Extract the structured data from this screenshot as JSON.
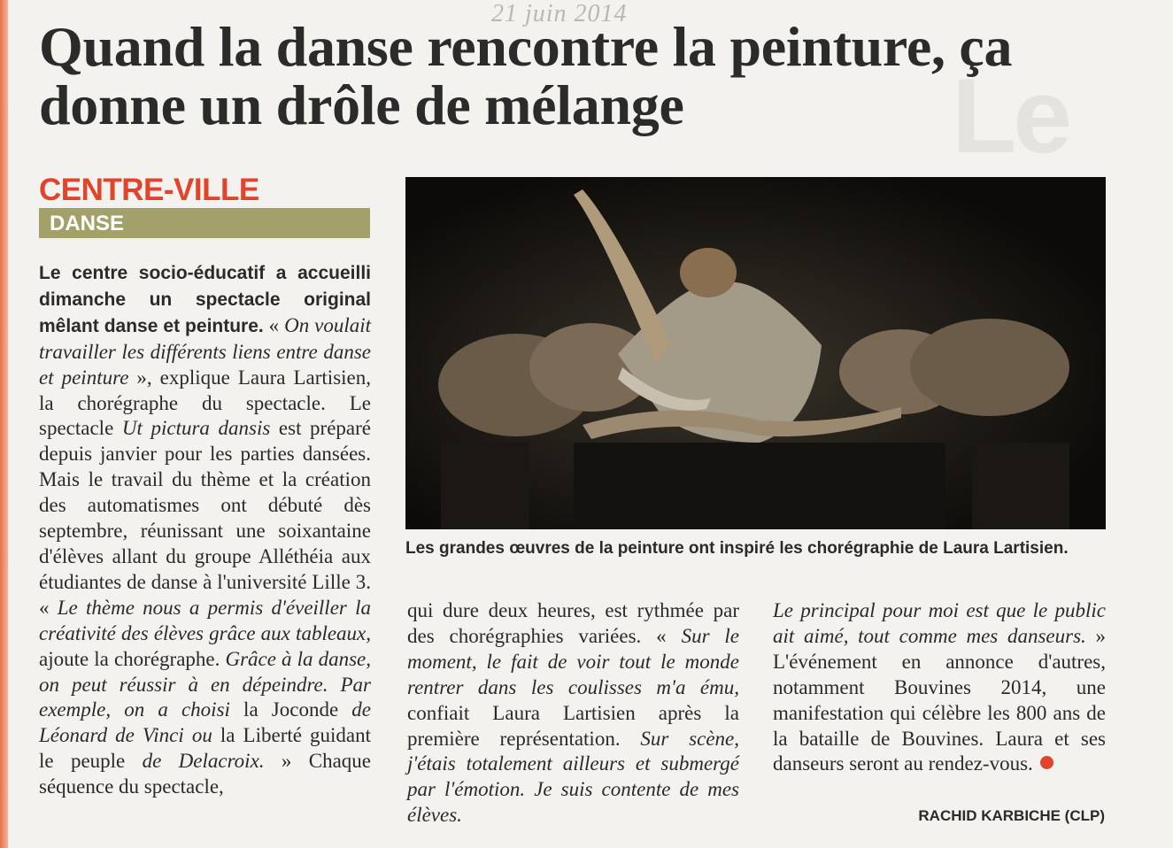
{
  "page": {
    "date_handwritten": "21 juin 2014",
    "ghost_text": "Le",
    "accent_color": "#e0452c",
    "category_color": "#a3a06a"
  },
  "article": {
    "headline": "Quand la danse rencontre la peinture, ça donne un drôle de mélange",
    "section": "CENTRE-VILLE",
    "category": "DANSE",
    "byline": "RACHID KARBICHE (CLP)",
    "caption": "Les grandes œuvres de la peinture ont inspiré les chorégraphie de Laura Lartisien.",
    "col1": [
      "Le centre socio-éducatif a accueilli dimanche un spectacle original mêlant danse et peinture.",
      " « ",
      "On voulait travailler les différents liens entre danse et peinture",
      " », explique Laura Lartisien, la chorégraphe du spectacle. Le spectacle ",
      "Ut pictura dansis",
      " est préparé depuis janvier pour les parties dansées. Mais le travail du thème et la création des automatismes ont débuté dès septembre, réunissant une soixantaine d'élèves allant du groupe Alléthéia aux étudiantes de danse à l'université Lille 3. « ",
      "Le thème nous a permis d'éveiller la créativité des élèves grâce aux tableaux,",
      " ajoute la chorégraphe. ",
      "Grâce à la danse, on peut réussir à en dépeindre. Par exemple, on a choisi",
      " la Joconde ",
      "de Léonard de Vinci ou",
      " la Liberté guidant le peuple ",
      "de Delacroix.",
      " » Chaque séquence du spectacle,"
    ],
    "col2": [
      "qui dure deux heures, est rythmée par des chorégraphies variées. « ",
      "Sur le moment, le fait de voir tout le monde rentrer dans les coulisses m'a ému,",
      " confiait Laura Lartisien après la première représentation. ",
      "Sur scène, j'étais totalement ailleurs et submergé par l'émotion. Je suis contente de mes élèves."
    ],
    "col3": [
      "Le principal pour moi est que le public ait aimé, tout comme mes danseurs.",
      " » L'événement en annonce d'autres, notamment Bouvines 2014, une manifestation qui célèbre les 800 ans de la bataille de Bouvines. Laura et ses danseurs seront au rendez-vous."
    ]
  }
}
